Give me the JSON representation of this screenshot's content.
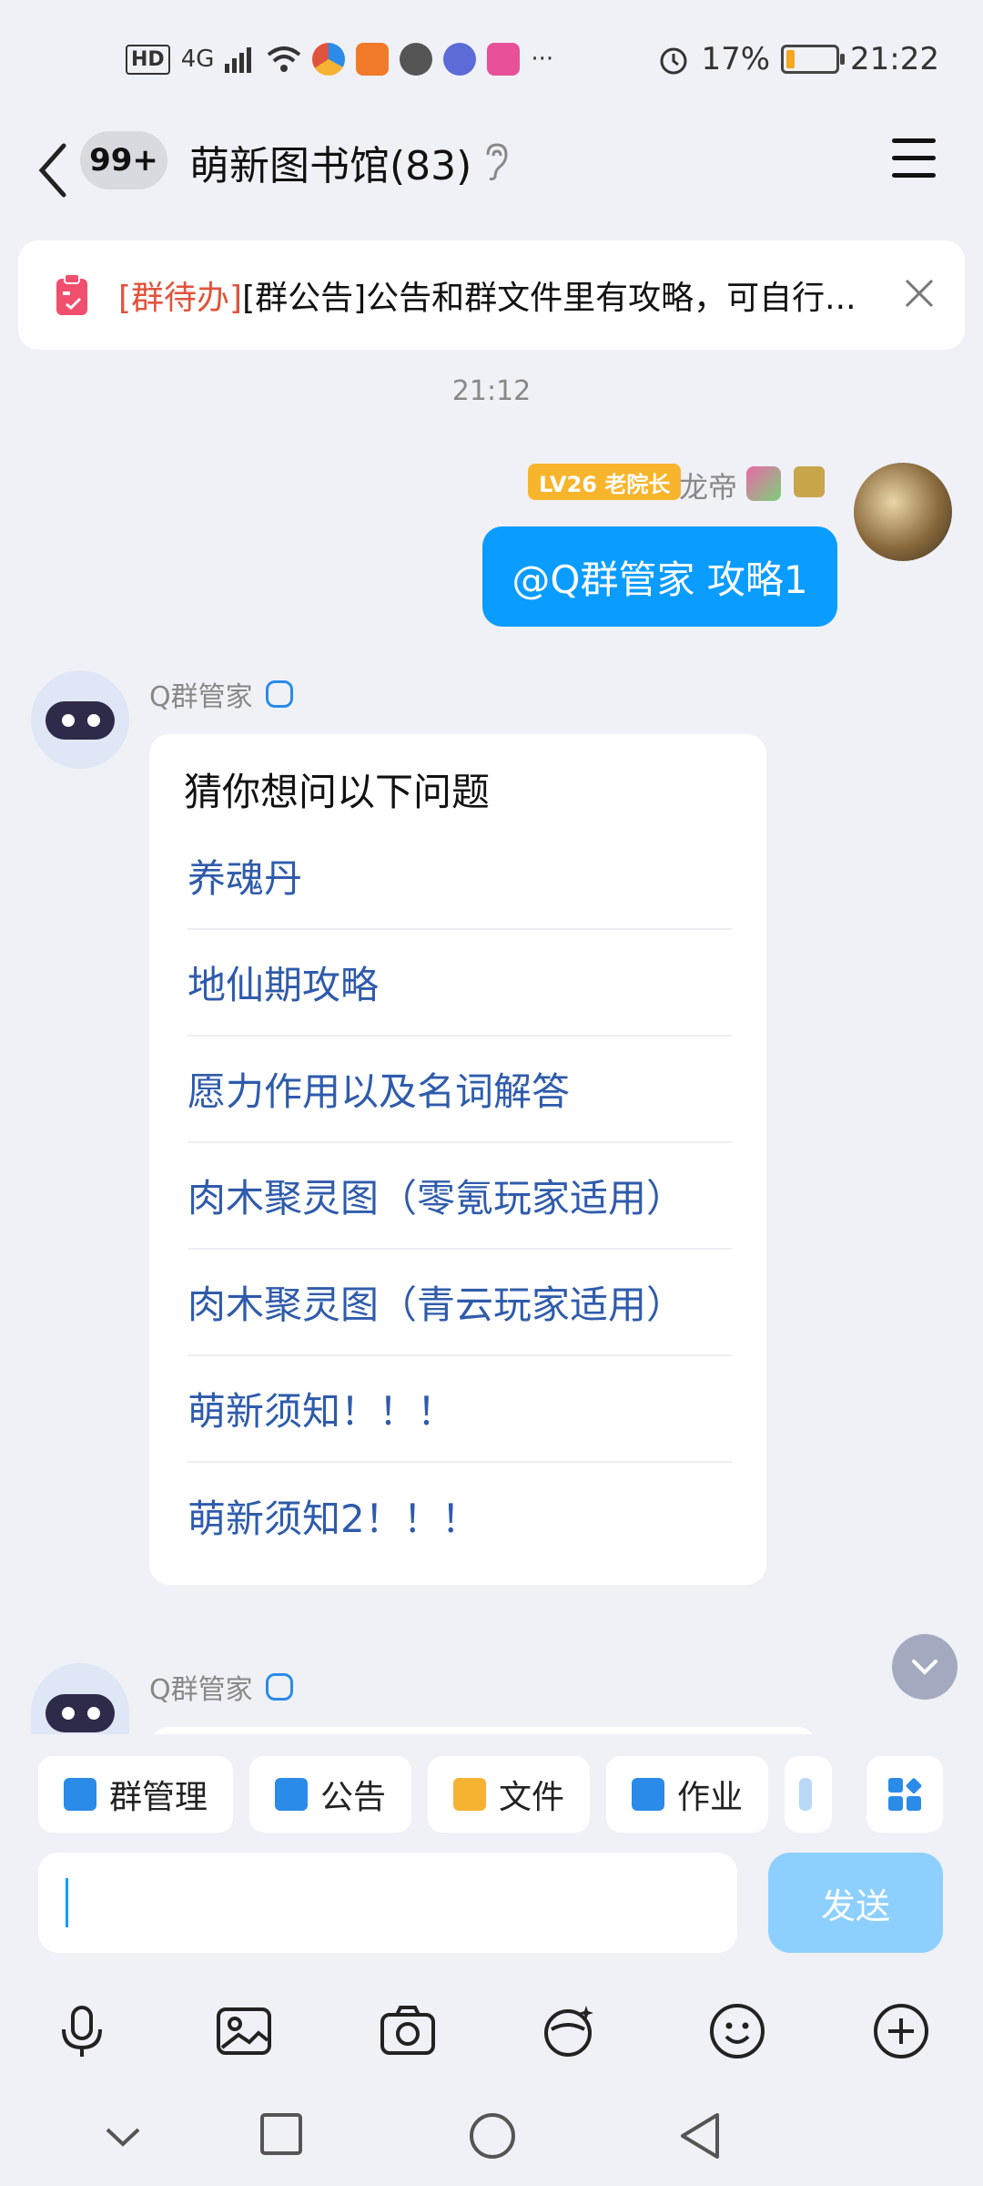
{
  "status_bar": {
    "hd": "HD",
    "network": "4G",
    "more": "···",
    "battery": "17%",
    "battery_level": 0.17,
    "time": "21:22"
  },
  "header": {
    "unread_badge": "99+",
    "title": "萌新图书馆(83)"
  },
  "notice": {
    "tag": "[群待办]",
    "text": "[群公告]公告和群文件里有攻略，可自行..."
  },
  "timestamp": "21:12",
  "my_message": {
    "level": "LV26 老院长",
    "nickname": "龙帝",
    "text": "@Q群管家 攻略1"
  },
  "bot_message": {
    "name": "Q群管家",
    "card_title": "猜你想问以下问题",
    "questions": [
      "养魂丹",
      "地仙期攻略",
      "愿力作用以及名词解答",
      "肉木聚灵图（零氪玩家适用）",
      "肉木聚灵图（青云玩家适用）",
      "萌新须知！！！",
      "萌新须知2！！！"
    ]
  },
  "bot_message_2": {
    "name": "Q群管家"
  },
  "shortcuts": [
    {
      "label": "群管理",
      "icon": "group-manage-icon",
      "color": "#2a8be8"
    },
    {
      "label": "公告",
      "icon": "announcement-icon",
      "color": "#2a8be8"
    },
    {
      "label": "文件",
      "icon": "folder-icon",
      "color": "#f5b233"
    },
    {
      "label": "作业",
      "icon": "homework-icon",
      "color": "#2a8be8"
    }
  ],
  "composer": {
    "send_label": "发送"
  },
  "colors": {
    "accent": "#0b9cff",
    "link": "#2f5bab",
    "notice_tag": "#e0533c",
    "level_badge": "#f7b52c"
  }
}
